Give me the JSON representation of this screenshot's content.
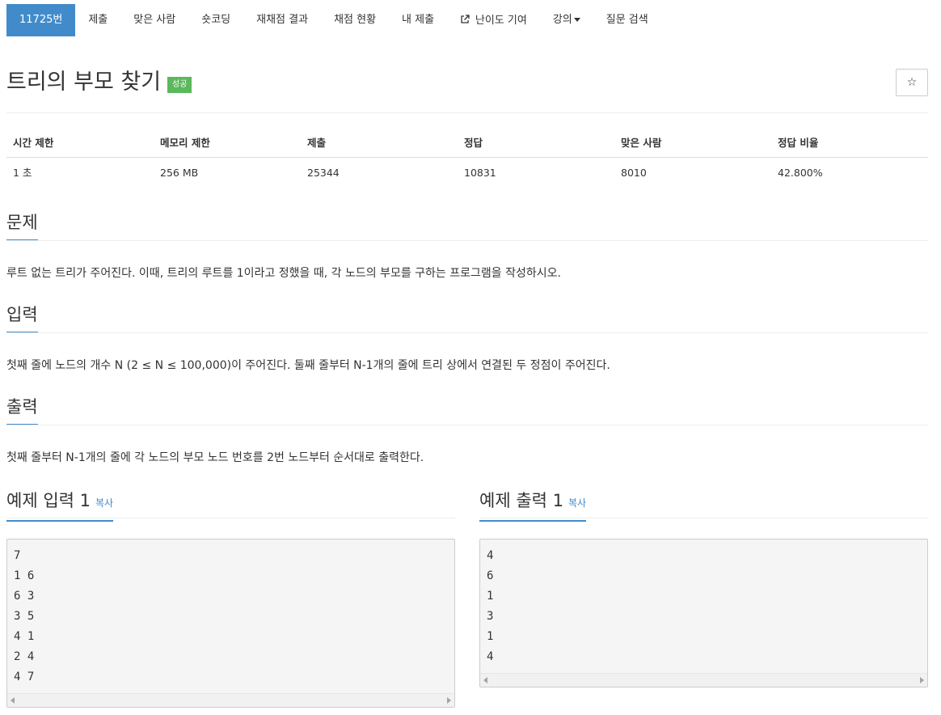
{
  "tabs": [
    {
      "label": "11725번",
      "active": true
    },
    {
      "label": "제출"
    },
    {
      "label": "맞은 사람"
    },
    {
      "label": "숏코딩"
    },
    {
      "label": "재채점 결과"
    },
    {
      "label": "채점 현황"
    },
    {
      "label": "내 제출"
    },
    {
      "label": "난이도 기여",
      "icon": "external-link-icon"
    },
    {
      "label": "강의",
      "icon": "caret-down-icon"
    },
    {
      "label": "질문 검색"
    }
  ],
  "problem": {
    "title": "트리의 부모 찾기",
    "status_badge": "성공",
    "star_symbol": "☆"
  },
  "stats": {
    "headers": [
      "시간 제한",
      "메모리 제한",
      "제출",
      "정답",
      "맞은 사람",
      "정답 비율"
    ],
    "values": [
      "1 초",
      "256 MB",
      "25344",
      "10831",
      "8010",
      "42.800%"
    ]
  },
  "sections": {
    "problem_heading": "문제",
    "problem_text": "루트 없는 트리가 주어진다. 이때, 트리의 루트를 1이라고 정했을 때, 각 노드의 부모를 구하는 프로그램을 작성하시오.",
    "input_heading": "입력",
    "input_text": "첫째 줄에 노드의 개수 N (2 ≤ N ≤ 100,000)이 주어진다. 둘째 줄부터 N-1개의 줄에 트리 상에서 연결된 두 정점이 주어진다.",
    "output_heading": "출력",
    "output_text": "첫째 줄부터 N-1개의 줄에 각 노드의 부모 노드 번호를 2번 노드부터 순서대로 출력한다."
  },
  "samples": {
    "input_heading": "예제 입력 1",
    "output_heading": "예제 출력 1",
    "copy_label": "복사",
    "input_lines": [
      "7",
      "1 6",
      "6 3",
      "3 5",
      "4 1",
      "2 4",
      "4 7"
    ],
    "output_lines": [
      "4",
      "6",
      "1",
      "3",
      "1",
      "4"
    ]
  },
  "colors": {
    "primary": "#428bca",
    "success": "#5cb85c"
  }
}
